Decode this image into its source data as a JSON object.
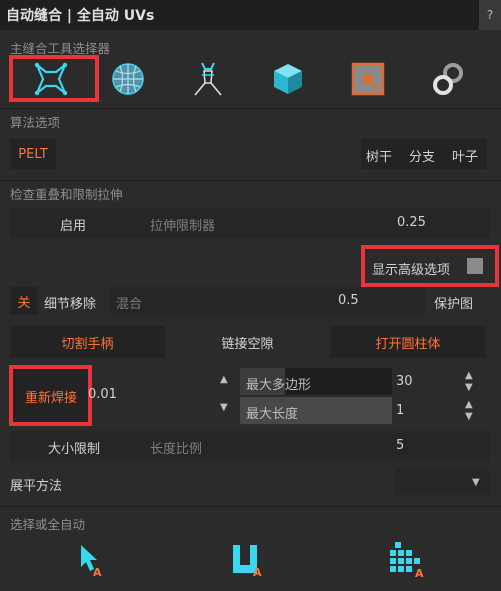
{
  "title": "自动缝合 | 全自动 UVs",
  "help": "?",
  "sections": {
    "main_tool": "主缝合工具选择器",
    "algorithm": "算法选项",
    "overlap": "检查重叠和限制拉伸",
    "unfold": "展平方法",
    "select_or_auto": "选择或全自动"
  },
  "tool_icons": [
    "seam-tool-icon",
    "sphere-icon",
    "figure-icon",
    "cube-icon",
    "point-box-icon",
    "link-icon"
  ],
  "algorithm": {
    "pelt": "PELT",
    "trunk": "树干",
    "branch": "分支",
    "leaf": "叶子"
  },
  "overlap": {
    "enable": "启用",
    "stretch_limiter": "拉伸限制器",
    "stretch_value": "0.25"
  },
  "advanced": {
    "label": "显示高级选项"
  },
  "detail": {
    "off": "关",
    "remove": "细节移除",
    "blend": "混合",
    "value": "0.5",
    "protect": "保护图"
  },
  "cut_row": {
    "cut_handle": "切割手柄",
    "link_gap": "链接空隙",
    "open_cylinder": "打开圆柱体"
  },
  "reweld": {
    "label": "重新焊接",
    "value": "0.01",
    "max_polygon": "最大多边形",
    "max_polygon_value": "30",
    "max_length": "最大长度",
    "max_length_value": "1"
  },
  "size": {
    "limit": "大小限制",
    "ratio": "长度比例",
    "value": "5"
  },
  "unfold_arrow": "▼",
  "bottom_icons": [
    "select-cursor-icon",
    "unfold-shape-icon",
    "grid-pack-icon"
  ],
  "colors": {
    "accent": "#ff7438",
    "cyan": "#3ad7ef",
    "highlight": "#e8353c"
  }
}
